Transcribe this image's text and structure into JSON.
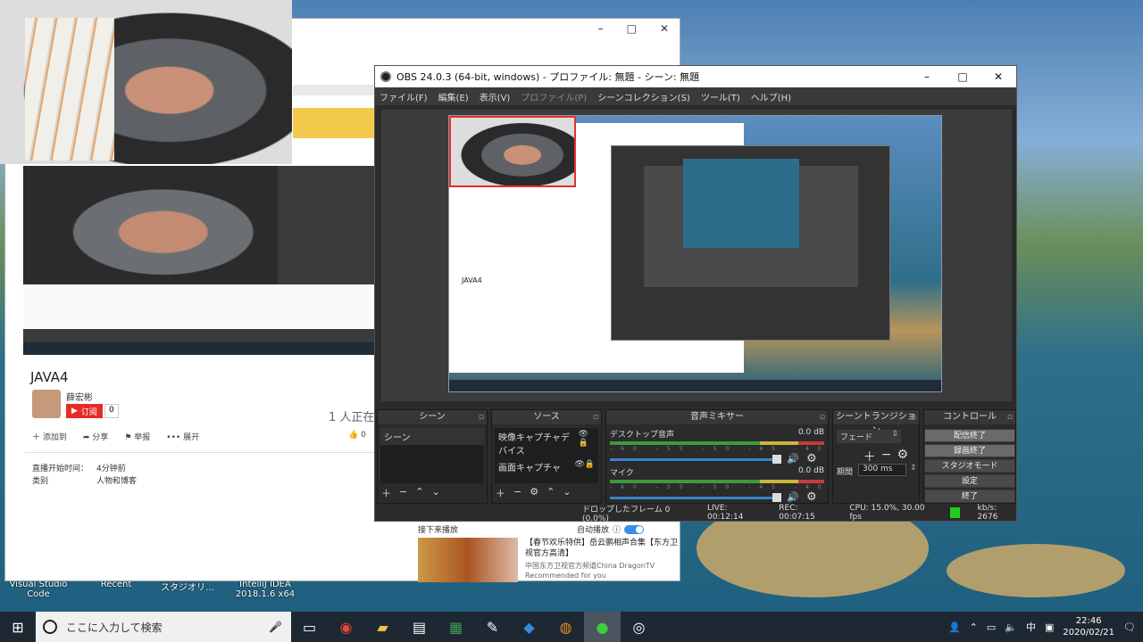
{
  "desktop": {
    "labels": [
      "Visual Studio Code",
      "Recent",
      "スタジオリ…",
      "IntelliJ IDEA 2018.1.6 x64"
    ]
  },
  "browser": {
    "minimize": "–",
    "maximize": "□",
    "close": "✕",
    "video_title": "JAVA4",
    "author": "薛宏彬",
    "subscribe_label": "订阅",
    "subscribe_count": "0",
    "viewers": "1 人正在",
    "actions": [
      "添加到",
      "分享",
      "举报",
      "展开"
    ],
    "like_count": "0",
    "info": [
      {
        "k": "直播开始时间：",
        "v": "4分钟前"
      },
      {
        "k": "类别",
        "v": "人物和博客"
      }
    ],
    "next_label": "接下来播放",
    "autoplay_label": "自动播放",
    "recommendation": {
      "title": "【春节欢乐特供】岳云鹏相声合集【东方卫视官方高清】",
      "channel": "中国东方卫视官方频道China DragonTV",
      "sub": "Recommended for you"
    }
  },
  "obs": {
    "title": "OBS 24.0.3 (64-bit, windows) - プロファイル: 無題 - シーン: 無題",
    "controls": [
      "–",
      "□",
      "✕"
    ],
    "menu": [
      {
        "label": "ファイル(F)",
        "enabled": true
      },
      {
        "label": "編集(E)",
        "enabled": true
      },
      {
        "label": "表示(V)",
        "enabled": true
      },
      {
        "label": "プロファイル(P)",
        "enabled": false
      },
      {
        "label": "シーンコレクション(S)",
        "enabled": true
      },
      {
        "label": "ツール(T)",
        "enabled": true
      },
      {
        "label": "ヘルプ(H)",
        "enabled": true
      }
    ],
    "preview_title": "JAVA4",
    "docks": {
      "scenes": {
        "title": "シーン",
        "items": [
          "シーン"
        ]
      },
      "sources": {
        "title": "ソース",
        "items": [
          "映像キャプチャデバイス",
          "画面キャプチャ"
        ]
      },
      "mixer": {
        "title": "音声ミキサー",
        "channels": [
          {
            "name": "デスクトップ音声",
            "db": "0.0 dB"
          },
          {
            "name": "マイク",
            "db": "0.0 dB"
          }
        ],
        "scale": "-60 -55 -50 -45 -40 -35 -30 -25 -20 -15 -10 -5 0"
      },
      "transitions": {
        "title": "シーントランジション",
        "type": "フェード",
        "duration_label": "期間",
        "duration": "300 ms"
      },
      "controls": {
        "title": "コントロール",
        "buttons": [
          "配信終了",
          "録画終了",
          "スタジオモード",
          "設定",
          "終了"
        ]
      }
    },
    "status": {
      "dropped": "ドロップしたフレーム 0 (0.0%)",
      "live": "LIVE: 00:12:14",
      "rec": "REC: 00:07:15",
      "cpu": "CPU: 15.0%, 30.00 fps",
      "kbps": "kb/s: 2676",
      "indicator_color": "#1ed01e"
    }
  },
  "taskbar": {
    "search_placeholder": "ここに入力して検索",
    "apps": [
      "task-view",
      "chrome",
      "file-explorer",
      "notepad",
      "excel",
      "paint",
      "vscode",
      "firefox",
      "wechat",
      "obs"
    ],
    "ime": "中",
    "time": "22:46",
    "date": "2020/02/21"
  }
}
